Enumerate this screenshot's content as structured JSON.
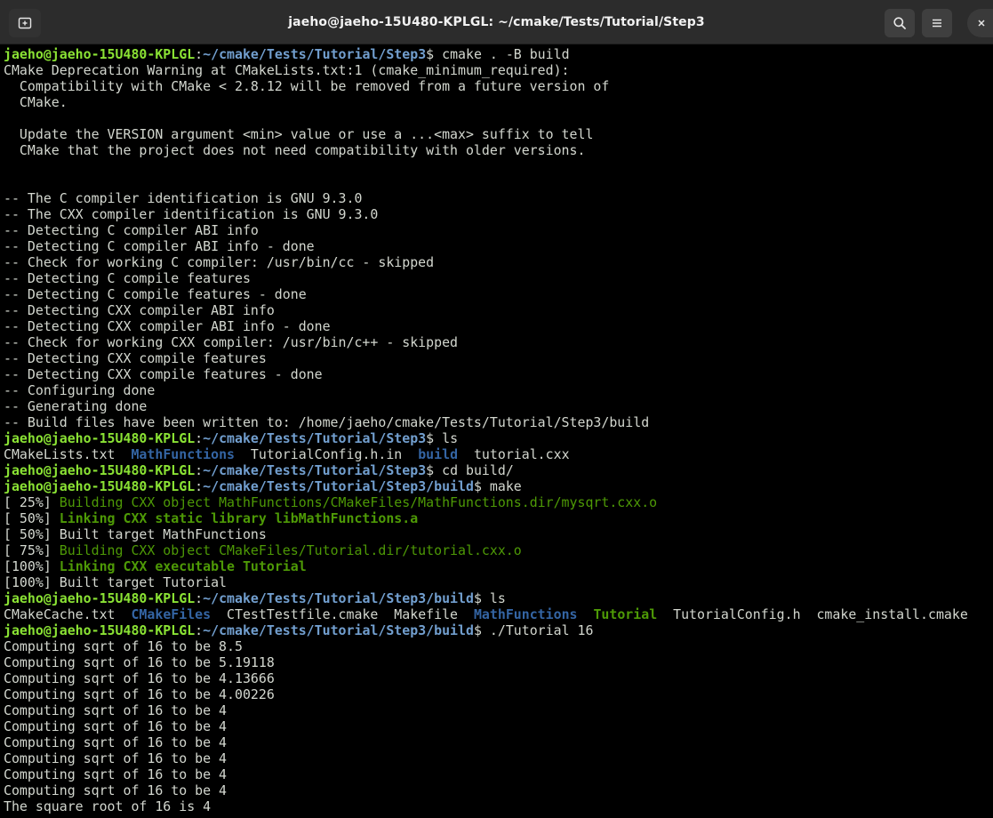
{
  "window": {
    "title": "jaeho@jaeho-15U480-KPLGL: ~/cmake/Tests/Tutorial/Step3",
    "icons": {
      "new_tab": "new-tab-icon",
      "search": "search-icon",
      "menu": "hamburger-menu-icon",
      "close": "close-icon"
    }
  },
  "colors": {
    "terminal_bg": "#000000",
    "titlebar_bg": "#2c2c2c",
    "text": "#d3d7cf",
    "prompt_user": "#8ae234",
    "prompt_path": "#729fcf",
    "make_progress": "#4e9a06",
    "directory": "#3465a4"
  },
  "terminal": {
    "lines": [
      [
        {
          "t": "jaeho@jaeho-15U480-KPLGL",
          "c": "u"
        },
        {
          "t": ":"
        },
        {
          "t": "~/cmake/Tests/Tutorial/Step3",
          "c": "p"
        },
        {
          "t": "$ cmake . -B build"
        }
      ],
      [
        {
          "t": "CMake Deprecation Warning at CMakeLists.txt:1 (cmake_minimum_required):"
        }
      ],
      [
        {
          "t": "  Compatibility with CMake < 2.8.12 will be removed from a future version of"
        }
      ],
      [
        {
          "t": "  CMake."
        }
      ],
      [
        {
          "t": ""
        }
      ],
      [
        {
          "t": "  Update the VERSION argument <min> value or use a ...<max> suffix to tell"
        }
      ],
      [
        {
          "t": "  CMake that the project does not need compatibility with older versions."
        }
      ],
      [
        {
          "t": ""
        }
      ],
      [
        {
          "t": ""
        }
      ],
      [
        {
          "t": "-- The C compiler identification is GNU 9.3.0"
        }
      ],
      [
        {
          "t": "-- The CXX compiler identification is GNU 9.3.0"
        }
      ],
      [
        {
          "t": "-- Detecting C compiler ABI info"
        }
      ],
      [
        {
          "t": "-- Detecting C compiler ABI info - done"
        }
      ],
      [
        {
          "t": "-- Check for working C compiler: /usr/bin/cc - skipped"
        }
      ],
      [
        {
          "t": "-- Detecting C compile features"
        }
      ],
      [
        {
          "t": "-- Detecting C compile features - done"
        }
      ],
      [
        {
          "t": "-- Detecting CXX compiler ABI info"
        }
      ],
      [
        {
          "t": "-- Detecting CXX compiler ABI info - done"
        }
      ],
      [
        {
          "t": "-- Check for working CXX compiler: /usr/bin/c++ - skipped"
        }
      ],
      [
        {
          "t": "-- Detecting CXX compile features"
        }
      ],
      [
        {
          "t": "-- Detecting CXX compile features - done"
        }
      ],
      [
        {
          "t": "-- Configuring done"
        }
      ],
      [
        {
          "t": "-- Generating done"
        }
      ],
      [
        {
          "t": "-- Build files have been written to: /home/jaeho/cmake/Tests/Tutorial/Step3/build"
        }
      ],
      [
        {
          "t": "jaeho@jaeho-15U480-KPLGL",
          "c": "u"
        },
        {
          "t": ":"
        },
        {
          "t": "~/cmake/Tests/Tutorial/Step3",
          "c": "p"
        },
        {
          "t": "$ ls"
        }
      ],
      [
        {
          "t": "CMakeLists.txt  "
        },
        {
          "t": "MathFunctions",
          "c": "dir"
        },
        {
          "t": "  TutorialConfig.h.in  "
        },
        {
          "t": "build",
          "c": "dir"
        },
        {
          "t": "  tutorial.cxx"
        }
      ],
      [
        {
          "t": "jaeho@jaeho-15U480-KPLGL",
          "c": "u"
        },
        {
          "t": ":"
        },
        {
          "t": "~/cmake/Tests/Tutorial/Step3",
          "c": "p"
        },
        {
          "t": "$ cd build/"
        }
      ],
      [
        {
          "t": "jaeho@jaeho-15U480-KPLGL",
          "c": "u"
        },
        {
          "t": ":"
        },
        {
          "t": "~/cmake/Tests/Tutorial/Step3/build",
          "c": "p"
        },
        {
          "t": "$ make"
        }
      ],
      [
        {
          "t": "[ 25%] "
        },
        {
          "t": "Building CXX object MathFunctions/CMakeFiles/MathFunctions.dir/mysqrt.cxx.o",
          "c": "g"
        }
      ],
      [
        {
          "t": "[ 50%] "
        },
        {
          "t": "Linking CXX static library libMathFunctions.a",
          "c": "gb"
        }
      ],
      [
        {
          "t": "[ 50%] Built target MathFunctions"
        }
      ],
      [
        {
          "t": "[ 75%] "
        },
        {
          "t": "Building CXX object CMakeFiles/Tutorial.dir/tutorial.cxx.o",
          "c": "g"
        }
      ],
      [
        {
          "t": "[100%] "
        },
        {
          "t": "Linking CXX executable Tutorial",
          "c": "gb"
        }
      ],
      [
        {
          "t": "[100%] Built target Tutorial"
        }
      ],
      [
        {
          "t": "jaeho@jaeho-15U480-KPLGL",
          "c": "u"
        },
        {
          "t": ":"
        },
        {
          "t": "~/cmake/Tests/Tutorial/Step3/build",
          "c": "p"
        },
        {
          "t": "$ ls"
        }
      ],
      [
        {
          "t": "CMakeCache.txt  "
        },
        {
          "t": "CMakeFiles",
          "c": "dir"
        },
        {
          "t": "  CTestTestfile.cmake  Makefile  "
        },
        {
          "t": "MathFunctions",
          "c": "dir"
        },
        {
          "t": "  "
        },
        {
          "t": "Tutorial",
          "c": "exe"
        },
        {
          "t": "  TutorialConfig.h  cmake_install.cmake"
        }
      ],
      [
        {
          "t": "jaeho@jaeho-15U480-KPLGL",
          "c": "u"
        },
        {
          "t": ":"
        },
        {
          "t": "~/cmake/Tests/Tutorial/Step3/build",
          "c": "p"
        },
        {
          "t": "$ ./Tutorial 16"
        }
      ],
      [
        {
          "t": "Computing sqrt of 16 to be 8.5"
        }
      ],
      [
        {
          "t": "Computing sqrt of 16 to be 5.19118"
        }
      ],
      [
        {
          "t": "Computing sqrt of 16 to be 4.13666"
        }
      ],
      [
        {
          "t": "Computing sqrt of 16 to be 4.00226"
        }
      ],
      [
        {
          "t": "Computing sqrt of 16 to be 4"
        }
      ],
      [
        {
          "t": "Computing sqrt of 16 to be 4"
        }
      ],
      [
        {
          "t": "Computing sqrt of 16 to be 4"
        }
      ],
      [
        {
          "t": "Computing sqrt of 16 to be 4"
        }
      ],
      [
        {
          "t": "Computing sqrt of 16 to be 4"
        }
      ],
      [
        {
          "t": "Computing sqrt of 16 to be 4"
        }
      ],
      [
        {
          "t": "The square root of 16 is 4"
        }
      ]
    ]
  }
}
